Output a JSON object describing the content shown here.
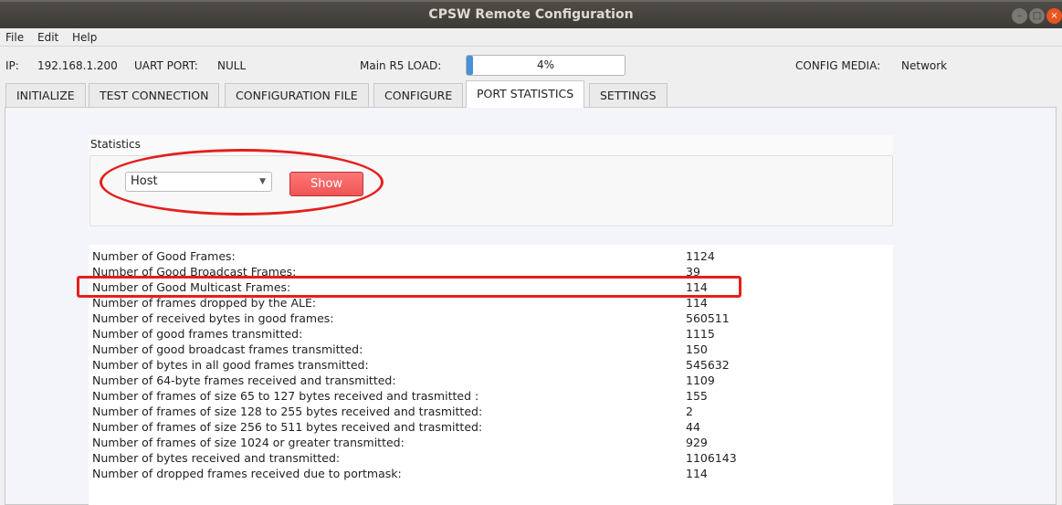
{
  "window": {
    "title": "CPSW Remote Configuration"
  },
  "menu": [
    "File",
    "Edit",
    "Help"
  ],
  "info": {
    "ip_label": "IP:",
    "ip": "192.168.1.200",
    "uart_label": "UART PORT:",
    "uart": "NULL",
    "load_label": "Main R5 LOAD:",
    "load_percent": 4,
    "load_text": "4%",
    "media_label": "CONFIG MEDIA:",
    "media": "Network"
  },
  "tabs": [
    "INITIALIZE",
    "TEST CONNECTION",
    "CONFIGURATION FILE",
    "CONFIGURE",
    "PORT STATISTICS",
    "SETTINGS"
  ],
  "active_tab": "PORT STATISTICS",
  "statistics": {
    "label": "Statistics",
    "port_select": "Host",
    "show_label": "Show",
    "accent": "#e85555"
  },
  "stats": [
    {
      "label": "Number of Good Frames:",
      "value": "1124"
    },
    {
      "label": "Number of Good Broadcast Frames:",
      "value": "39"
    },
    {
      "label": "Number of Good Multicast Frames:",
      "value": "114"
    },
    {
      "label": "Number of frames dropped by the ALE:",
      "value": "114"
    },
    {
      "label": "Number of received bytes in good frames:",
      "value": "560511"
    },
    {
      "label": "Number of good frames transmitted:",
      "value": "1115"
    },
    {
      "label": "Number of good broadcast frames transmitted:",
      "value": "150"
    },
    {
      "label": "Number of bytes in all good frames transmitted:",
      "value": "545632"
    },
    {
      "label": "Number of 64-byte frames received and transmitted:",
      "value": "1109"
    },
    {
      "label": "Number of frames of size 65 to 127 bytes received and trasmitted :",
      "value": "155"
    },
    {
      "label": "Number of frames of size 128 to 255 bytes received and trasmitted:",
      "value": "2"
    },
    {
      "label": "Number of frames of size 256 to 511 bytes received and trasmitted:",
      "value": "44"
    },
    {
      "label": "Number of frames of size 1024 or greater transmitted:",
      "value": "929"
    },
    {
      "label": "Number of bytes received and transmitted:",
      "value": "1106143"
    },
    {
      "label": "Number of dropped frames received due to portmask:",
      "value": "114"
    }
  ]
}
